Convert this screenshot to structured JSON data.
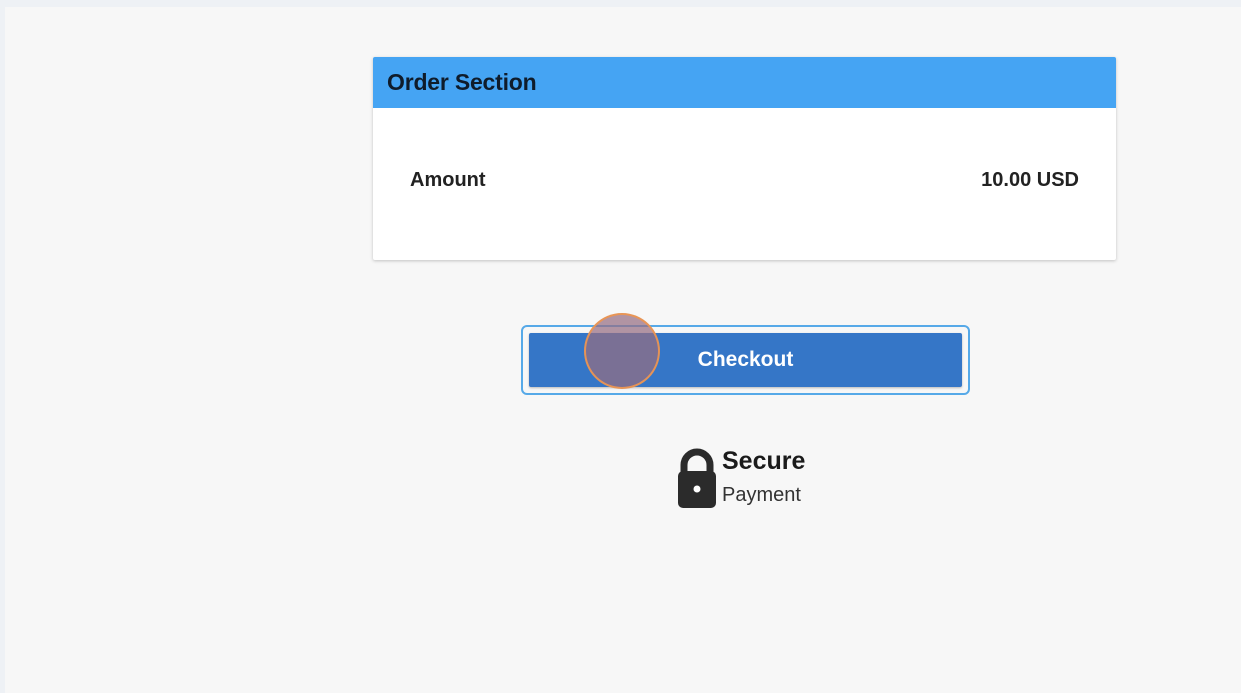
{
  "order_section": {
    "title": "Order Section",
    "amount_label": "Amount",
    "amount_value": "10.00 USD"
  },
  "checkout": {
    "label": "Checkout"
  },
  "secure_badge": {
    "title": "Secure",
    "subtitle": "Payment",
    "icon": "lock-icon"
  },
  "colors": {
    "header_blue": "#45a4f3",
    "button_blue": "#3576c7",
    "focus_outline": "#56a9e8",
    "page_bg": "#f7f7f7"
  }
}
